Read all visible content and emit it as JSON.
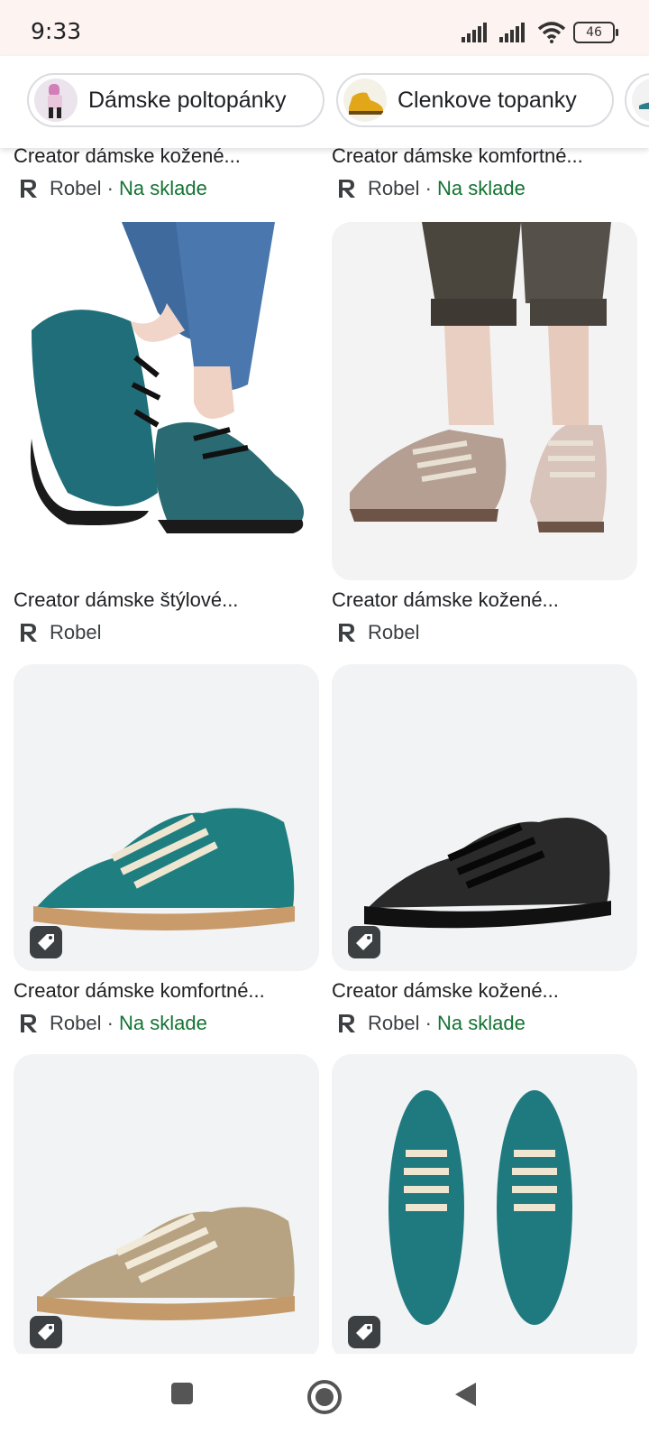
{
  "status": {
    "time": "9:33",
    "battery": "46"
  },
  "chips": [
    {
      "label": "Dámske poltopánky",
      "icon": "person-thumbnail"
    },
    {
      "label": "Clenkove topanky",
      "icon": "yellow-shoe-thumbnail"
    },
    {
      "label": "",
      "icon": "shoe-thumbnail"
    }
  ],
  "top_row": [
    {
      "title": "Creator dámske kožené...",
      "merchant": "Robel",
      "separator": " · ",
      "stock": "Na sklade"
    },
    {
      "title": "Creator dámske komfortné...",
      "merchant": "Robel",
      "separator": " · ",
      "stock": "Na sklade"
    }
  ],
  "row2": [
    {
      "title": "Creator dámske štýlové...",
      "merchant": "Robel"
    },
    {
      "title": "Creator dámske kožené...",
      "merchant": "Robel"
    }
  ],
  "row3": [
    {
      "title": "Creator dámske komfortné...",
      "merchant": "Robel",
      "separator": " · ",
      "stock": "Na sklade"
    },
    {
      "title": "Creator dámske kožené...",
      "merchant": "Robel",
      "separator": " · ",
      "stock": "Na sklade"
    }
  ],
  "colors": {
    "stock_green": "#137333",
    "status_bg": "#fdf3f1",
    "card_bg": "#f1f3f4"
  }
}
